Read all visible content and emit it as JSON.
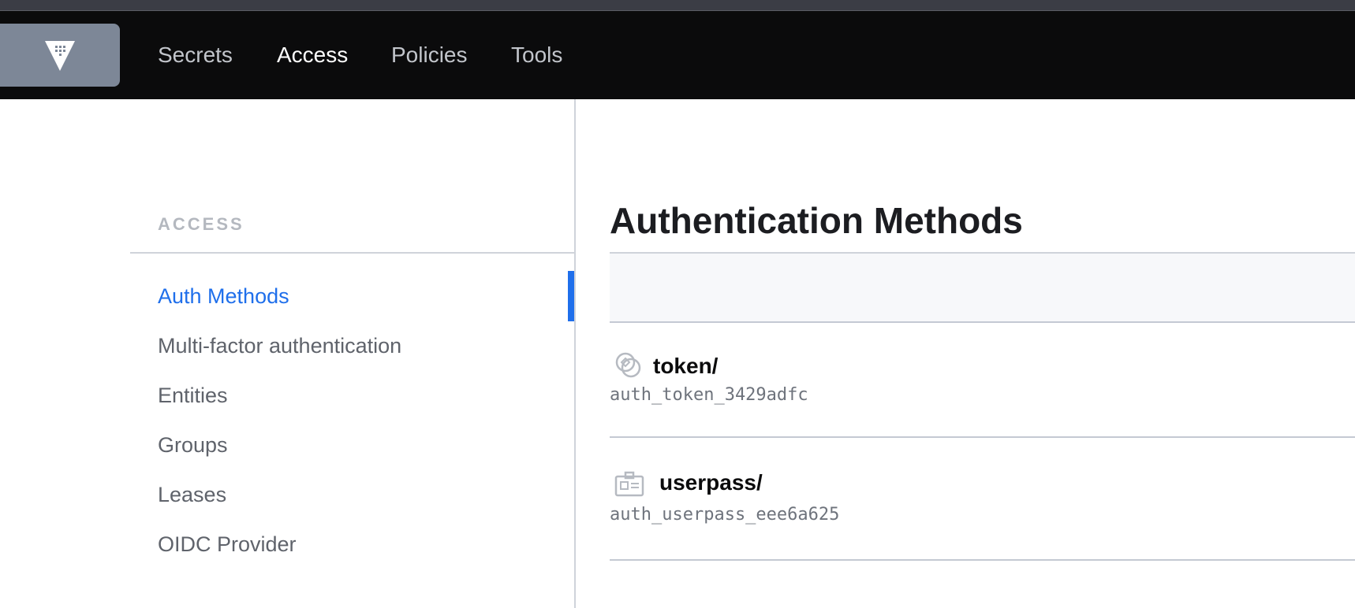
{
  "nav": {
    "logo_icon": "vault-logo-icon",
    "items": [
      {
        "label": "Secrets",
        "active": false
      },
      {
        "label": "Access",
        "active": true
      },
      {
        "label": "Policies",
        "active": false
      },
      {
        "label": "Tools",
        "active": false
      }
    ]
  },
  "sidebar": {
    "heading": "ACCESS",
    "items": [
      {
        "label": "Auth Methods",
        "active": true
      },
      {
        "label": "Multi-factor authentication",
        "active": false
      },
      {
        "label": "Entities",
        "active": false
      },
      {
        "label": "Groups",
        "active": false
      },
      {
        "label": "Leases",
        "active": false
      },
      {
        "label": "OIDC Provider",
        "active": false
      }
    ]
  },
  "main": {
    "title": "Authentication Methods",
    "methods": [
      {
        "name": "token/",
        "accessor": "auth_token_3429adfc",
        "icon": "token-icon"
      },
      {
        "name": "userpass/",
        "accessor": "auth_userpass_eee6a625",
        "icon": "userpass-icon"
      }
    ]
  },
  "colors": {
    "accent": "#1f6feb",
    "navbar": "#0b0b0c",
    "logo_bg": "#7d8797"
  }
}
